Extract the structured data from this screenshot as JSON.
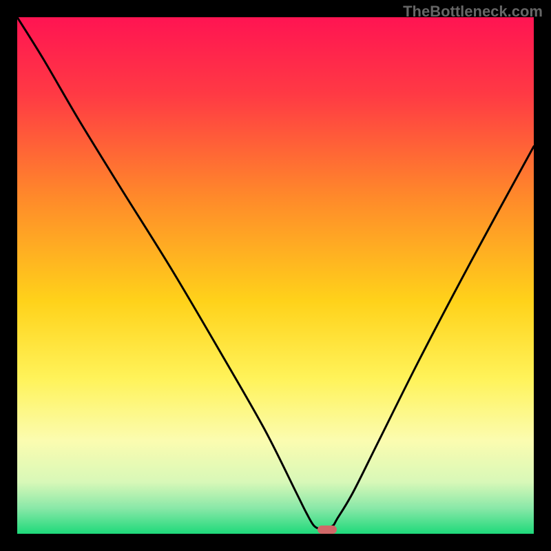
{
  "watermark": "TheBottleneck.com",
  "chart_data": {
    "type": "line",
    "title": "",
    "xlabel": "",
    "ylabel": "",
    "xlim": [
      0,
      100
    ],
    "ylim": [
      0,
      100
    ],
    "series": [
      {
        "name": "bottleneck-curve",
        "x": [
          0,
          5,
          12,
          20,
          30,
          40,
          48,
          54,
          56,
          57.5,
          59,
          61,
          62,
          65,
          70,
          78,
          88,
          100
        ],
        "y": [
          100,
          92,
          80,
          67,
          51,
          34,
          20,
          8,
          4,
          1.5,
          1,
          1.5,
          3,
          8,
          18,
          34,
          53,
          75
        ]
      }
    ],
    "marker": {
      "name": "optimal-point",
      "x": 60,
      "y": 0.8,
      "color": "#d06868"
    },
    "gradient_stops": [
      {
        "offset": 0,
        "color": "#ff1452"
      },
      {
        "offset": 15,
        "color": "#ff3a44"
      },
      {
        "offset": 35,
        "color": "#ff8a2a"
      },
      {
        "offset": 55,
        "color": "#ffd21a"
      },
      {
        "offset": 70,
        "color": "#fff35a"
      },
      {
        "offset": 82,
        "color": "#fbfcb0"
      },
      {
        "offset": 90,
        "color": "#d8f8b8"
      },
      {
        "offset": 95,
        "color": "#8ae8a8"
      },
      {
        "offset": 100,
        "color": "#1ed97a"
      }
    ]
  }
}
